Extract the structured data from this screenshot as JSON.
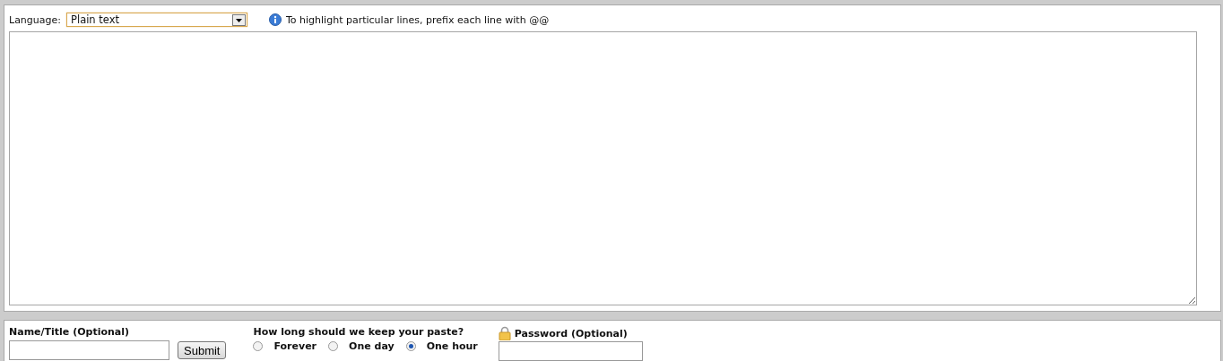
{
  "editor": {
    "language_label": "Language:",
    "language": "Plain text",
    "hint": "To highlight particular lines, prefix each line with @@"
  },
  "name_field": {
    "label": "Name/Title (Optional)"
  },
  "submit": "Submit",
  "expiry": {
    "label": "How long should we keep your paste?",
    "options": [
      {
        "label": "Forever",
        "selected": false
      },
      {
        "label": "One day",
        "selected": false
      },
      {
        "label": "One hour",
        "selected": true
      }
    ]
  },
  "password_field": {
    "label": "Password (Optional)"
  }
}
